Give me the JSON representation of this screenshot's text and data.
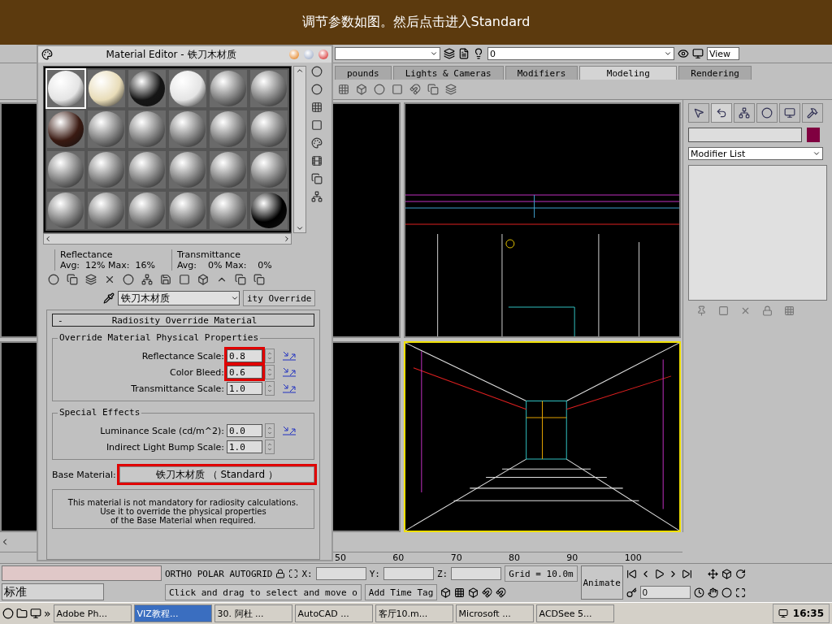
{
  "banner": {
    "text": "调节参数如图。然后点击进入Standard"
  },
  "toolbar": {
    "layer": "0",
    "view": "View"
  },
  "main_tabs": [
    {
      "label": "pounds",
      "selected": false
    },
    {
      "label": "Lights & Cameras",
      "selected": false
    },
    {
      "label": "Modifiers",
      "selected": false
    },
    {
      "label": "Modeling",
      "selected": true
    },
    {
      "label": "Rendering",
      "selected": false
    }
  ],
  "viewports": [
    {
      "kind": "partial",
      "active": false
    },
    {
      "kind": "elevation",
      "active": false
    },
    {
      "kind": "partial",
      "active": false
    },
    {
      "kind": "perspective",
      "active": true
    }
  ],
  "command_panel": {
    "tabs": [
      {
        "selected": false
      },
      {
        "selected": true
      },
      {
        "selected": false
      },
      {
        "selected": false
      },
      {
        "selected": false
      },
      {
        "selected": false
      }
    ],
    "modifier_list": "Modifier List"
  },
  "material_editor": {
    "title": "Material Editor - 铁刀木材质",
    "slots": [
      {
        "kind": "white",
        "selected": true
      },
      {
        "kind": "cream",
        "selected": false
      },
      {
        "kind": "dark",
        "selected": false
      },
      {
        "kind": "white",
        "selected": false
      },
      {
        "kind": "grey",
        "selected": false
      },
      {
        "kind": "grey",
        "selected": false
      },
      {
        "kind": "brown",
        "selected": false
      },
      {
        "kind": "grey",
        "selected": false
      },
      {
        "kind": "grey",
        "selected": false
      },
      {
        "kind": "grey",
        "selected": false
      },
      {
        "kind": "grey",
        "selected": false
      },
      {
        "kind": "grey",
        "selected": false
      },
      {
        "kind": "grey",
        "selected": false
      },
      {
        "kind": "grey",
        "selected": false
      },
      {
        "kind": "grey",
        "selected": false
      },
      {
        "kind": "grey",
        "selected": false
      },
      {
        "kind": "grey",
        "selected": false
      },
      {
        "kind": "grey",
        "selected": false
      },
      {
        "kind": "grey",
        "selected": false
      },
      {
        "kind": "grey",
        "selected": false
      },
      {
        "kind": "grey",
        "selected": false
      },
      {
        "kind": "grey",
        "selected": false
      },
      {
        "kind": "grey",
        "selected": false
      },
      {
        "kind": "black",
        "selected": false
      }
    ],
    "reflectance_label": "Reflectance",
    "reflectance_values": "Avg:  12% Max:  16%",
    "transmittance_label": "Transmittance",
    "transmittance_values": "Avg:    0% Max:    0%",
    "material_name": "铁刀木材质",
    "type_button": "ity Override",
    "rollout_toggle": "-",
    "rollout_title": "Radiosity Override Material",
    "physical_group": {
      "title": "Override Material Physical Properties",
      "params": [
        {
          "label": "Reflectance Scale:",
          "value": "0.8",
          "highlighted": true,
          "linked": true
        },
        {
          "label": "Color Bleed:",
          "value": "0.6",
          "highlighted": true,
          "linked": true
        },
        {
          "label": "Transmittance Scale:",
          "value": "1.0",
          "highlighted": false,
          "linked": true
        }
      ]
    },
    "effects_group": {
      "title": "Special Effects",
      "params": [
        {
          "label": "Luminance Scale (cd/m^2):",
          "value": "0.0",
          "highlighted": false,
          "linked": true
        },
        {
          "label": "Indirect Light Bump Scale:",
          "value": "1.0",
          "highlighted": false,
          "linked": false
        }
      ]
    },
    "base_material": {
      "label": "Base Material:",
      "button": "铁刀木材质  （ Standard ）",
      "highlighted": true
    },
    "note": "This material is not mandatory for radiosity calculations.\nUse it to override the physical properties\nof the Base Material when required."
  },
  "ruler": [
    "50",
    "60",
    "70",
    "80",
    "90",
    "100"
  ],
  "status": {
    "ime": "标准",
    "modes": "ORTHO  POLAR  AUTOGRID",
    "x_label": "X:",
    "y_label": "Y:",
    "z_label": "Z:",
    "grid": "Grid = 10.0m",
    "animate": "Animate",
    "prompt": "Click and drag to select and move o",
    "time_tag": "Add Time Tag",
    "frame": "0"
  },
  "taskbar": {
    "chevron": "»",
    "clock": "16:35",
    "tasks": [
      {
        "label": "Adobe Ph...",
        "selected": false
      },
      {
        "label": "VIZ教程...",
        "selected": true
      },
      {
        "label": "30. 阿杜 ...",
        "selected": false
      },
      {
        "label": "AutoCAD ...",
        "selected": false
      },
      {
        "label": "客厅10.m...",
        "selected": false
      },
      {
        "label": "Microsoft ...",
        "selected": false
      },
      {
        "label": "ACDSee 5...",
        "selected": false
      }
    ]
  }
}
